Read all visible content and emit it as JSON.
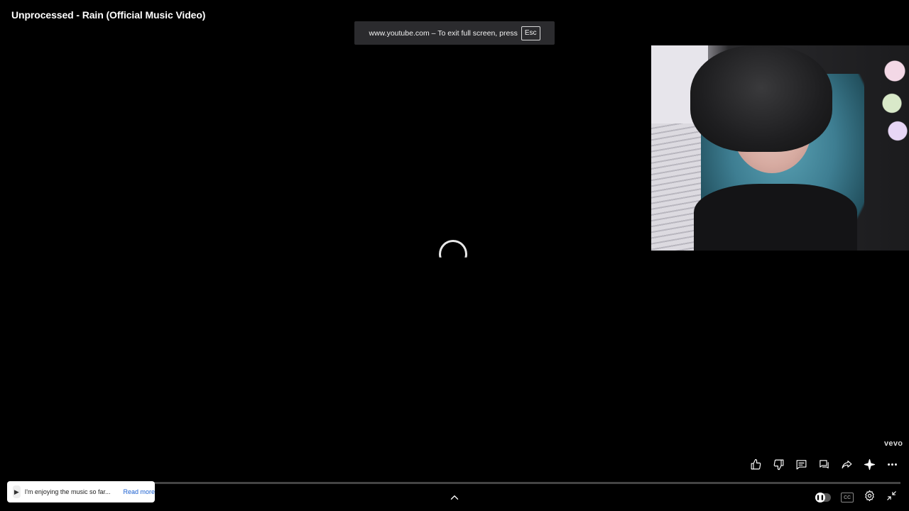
{
  "video": {
    "title": "Unprocessed - Rain (Official Music Video)",
    "channel_badge": "vevo"
  },
  "fullscreen_notice": {
    "text": "www.youtube.com – To exit full screen, press",
    "key": "Esc"
  },
  "toast": {
    "text": "I'm enjoying the music so far...",
    "link": "Read more"
  },
  "controls": {
    "cc_label": "CC",
    "autoplay_state": "on"
  },
  "icons": {
    "like": "thumbs-up-icon",
    "dislike": "thumbs-down-icon",
    "comments": "comment-icon",
    "chat": "chat-icon",
    "share": "share-icon",
    "ask": "sparkle-icon",
    "more": "more-icon",
    "settings": "gear-icon",
    "exit_fullscreen": "exit-fullscreen-icon"
  }
}
